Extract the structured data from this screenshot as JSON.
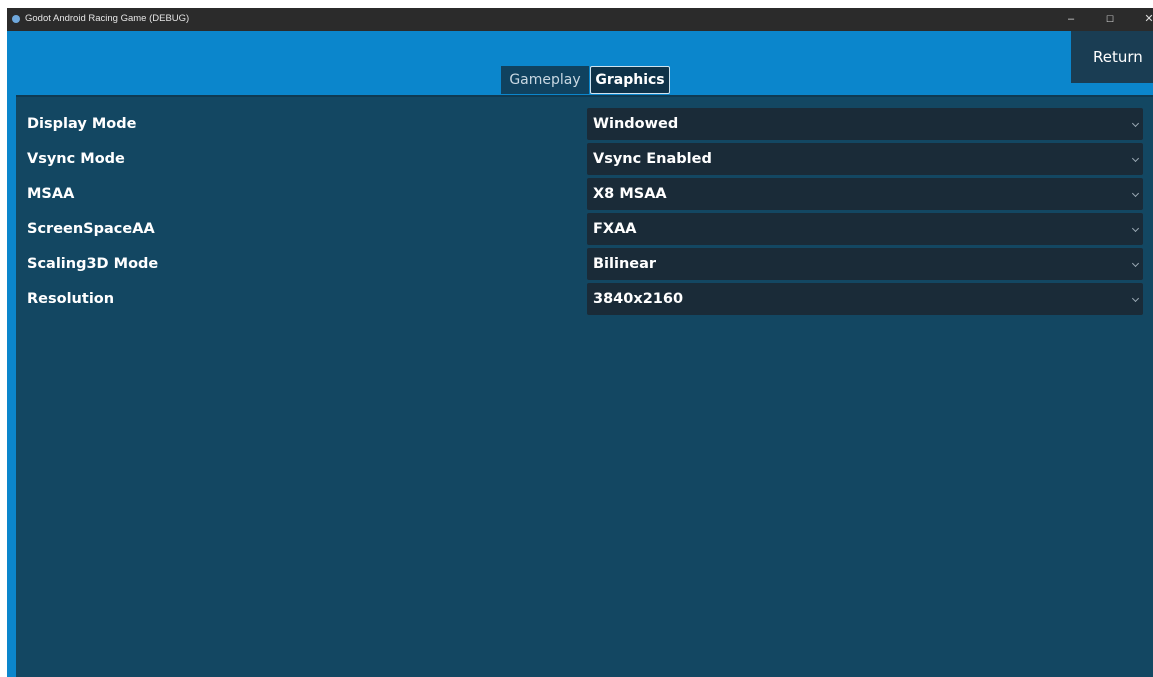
{
  "window": {
    "title": "Godot Android Racing Game (DEBUG)",
    "controls": {
      "minimize": "–",
      "maximize": "☐",
      "close": "✕"
    }
  },
  "header": {
    "return_label": "Return"
  },
  "tabs": [
    {
      "label": "Gameplay",
      "active": false
    },
    {
      "label": "Graphics",
      "active": true
    }
  ],
  "settings": [
    {
      "label": "Display Mode",
      "value": "Windowed",
      "icon": "chevron-down-icon"
    },
    {
      "label": "Vsync Mode",
      "value": "Vsync Enabled",
      "icon": "chevron-down-icon"
    },
    {
      "label": "MSAA",
      "value": "X8 MSAA",
      "icon": "chevron-down-icon"
    },
    {
      "label": "ScreenSpaceAA",
      "value": "FXAA",
      "icon": "chevron-down-icon"
    },
    {
      "label": "Scaling3D Mode",
      "value": "Bilinear",
      "icon": "chevron-down-icon"
    },
    {
      "label": "Resolution",
      "value": "3840x2160",
      "icon": "chevron-down-icon"
    }
  ],
  "colors": {
    "window_bg": "#0b86cc",
    "panel_bg": "#134762",
    "dropdown_bg": "#1a2b38",
    "titlebar_bg": "#2b2b2b"
  }
}
